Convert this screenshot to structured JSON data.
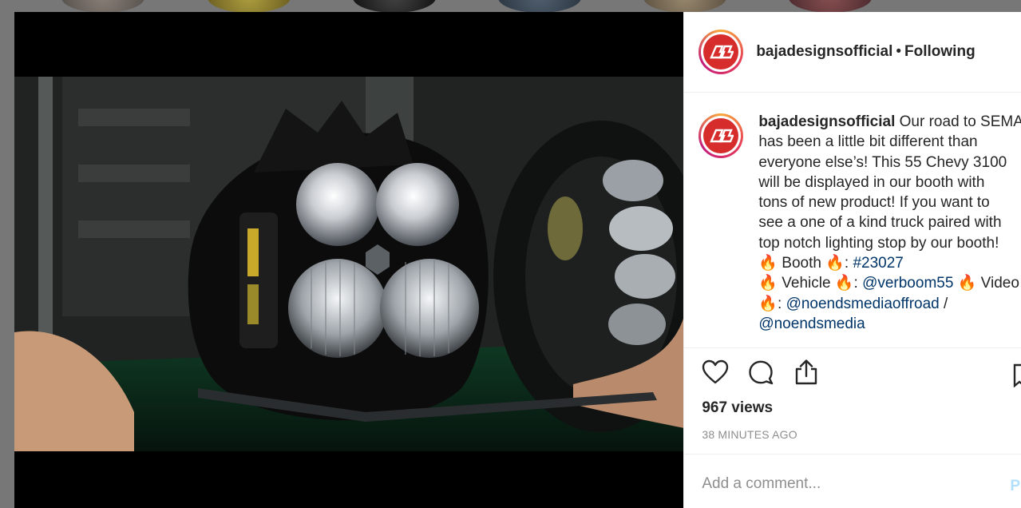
{
  "post": {
    "username": "bajadesignsofficial",
    "separator": "•",
    "follow_status": "Following",
    "caption_lines": [
      "Our road to SEMA",
      "has been a little bit different than",
      "everyone else’s! This 55 Chevy 3100",
      "will be displayed in our booth with",
      "tons of new product! If you want to",
      "see a one of a kind truck paired with",
      "top notch lighting stop by our booth!"
    ],
    "booth_label": " Booth ",
    "booth_tag": "#23027",
    "vehicle_label": " Vehicle ",
    "vehicle_handle": "@verboom55",
    "video_label": " Video",
    "video_handle_1": "@noendsmediaoffroad",
    "slash": " /",
    "video_handle_2": "@noendsmedia",
    "fire_emoji": "🔥",
    "colon": ": ",
    "views": "967 views",
    "timestamp": "38 MINUTES AGO",
    "comment_placeholder": "Add a comment...",
    "post_button": "Po"
  },
  "icons": {
    "like": "heart-icon",
    "comment": "comment-icon",
    "share": "share-icon",
    "save": "bookmark-icon"
  },
  "colors": {
    "link": "#003569",
    "logo_red": "#d62c2c",
    "muted": "#8e8e8e",
    "post_disabled": "#b2dffc"
  }
}
